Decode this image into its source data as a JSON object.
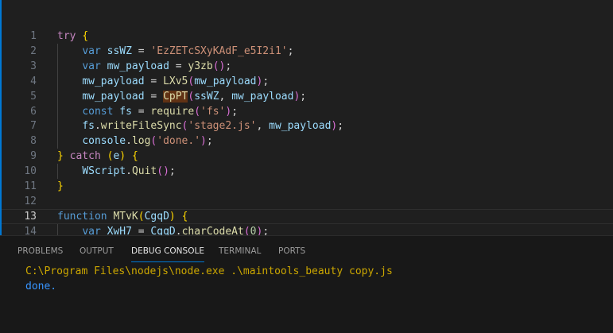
{
  "editor": {
    "active_line": 13,
    "highlight_token": "CpPT",
    "lines": [
      {
        "n": "1",
        "indent": 0,
        "t": [
          [
            "ctl",
            "try"
          ],
          [
            "",
            ""
          ],
          [
            "",
            " "
          ],
          [
            "b1",
            "{"
          ]
        ]
      },
      {
        "n": "2",
        "indent": 1,
        "t": [
          [
            "kw",
            "var"
          ],
          [
            "",
            " "
          ],
          [
            "id",
            "ssWZ"
          ],
          [
            "",
            " = "
          ],
          [
            "str",
            "'EzZETcSXyKAdF_e5I2i1'"
          ],
          [
            "",
            ";"
          ]
        ]
      },
      {
        "n": "3",
        "indent": 1,
        "t": [
          [
            "kw",
            "var"
          ],
          [
            "",
            " "
          ],
          [
            "id",
            "mw_payload"
          ],
          [
            "",
            " = "
          ],
          [
            "fn",
            "y3zb"
          ],
          [
            "b2",
            "()"
          ],
          [
            "",
            ";"
          ]
        ]
      },
      {
        "n": "4",
        "indent": 1,
        "t": [
          [
            "id",
            "mw_payload"
          ],
          [
            "",
            " = "
          ],
          [
            "fn",
            "LXv5"
          ],
          [
            "b2",
            "("
          ],
          [
            "id",
            "mw_payload"
          ],
          [
            "b2",
            ")"
          ],
          [
            "",
            ";"
          ]
        ]
      },
      {
        "n": "5",
        "indent": 1,
        "t": [
          [
            "id",
            "mw_payload"
          ],
          [
            "",
            " = "
          ],
          [
            "fn hl",
            "CpPT"
          ],
          [
            "b2",
            "("
          ],
          [
            "id",
            "ssWZ"
          ],
          [
            "",
            ", "
          ],
          [
            "id",
            "mw_payload"
          ],
          [
            "b2",
            ")"
          ],
          [
            "",
            ";"
          ]
        ]
      },
      {
        "n": "6",
        "indent": 1,
        "t": [
          [
            "kw",
            "const"
          ],
          [
            "",
            " "
          ],
          [
            "id",
            "fs"
          ],
          [
            "",
            " = "
          ],
          [
            "fn",
            "require"
          ],
          [
            "b2",
            "("
          ],
          [
            "str",
            "'fs'"
          ],
          [
            "b2",
            ")"
          ],
          [
            "",
            ";"
          ]
        ]
      },
      {
        "n": "7",
        "indent": 1,
        "t": [
          [
            "id",
            "fs"
          ],
          [
            "",
            "."
          ],
          [
            "fn",
            "writeFileSync"
          ],
          [
            "b2",
            "("
          ],
          [
            "str",
            "'stage2.js'"
          ],
          [
            "",
            ", "
          ],
          [
            "id",
            "mw_payload"
          ],
          [
            "b2",
            ")"
          ],
          [
            "",
            ";"
          ]
        ]
      },
      {
        "n": "8",
        "indent": 1,
        "t": [
          [
            "id",
            "console"
          ],
          [
            "",
            "."
          ],
          [
            "fn",
            "log"
          ],
          [
            "b2",
            "("
          ],
          [
            "str",
            "'done.'"
          ],
          [
            "b2",
            ")"
          ],
          [
            "",
            ";"
          ]
        ]
      },
      {
        "n": "9",
        "indent": 0,
        "t": [
          [
            "b1",
            "}"
          ],
          [
            "",
            " "
          ],
          [
            "ctl",
            "catch"
          ],
          [
            "",
            " "
          ],
          [
            "b1",
            "("
          ],
          [
            "id",
            "e"
          ],
          [
            "b1",
            ")"
          ],
          [
            "",
            " "
          ],
          [
            "b1",
            "{"
          ]
        ]
      },
      {
        "n": "10",
        "indent": 1,
        "t": [
          [
            "id",
            "WScript"
          ],
          [
            "",
            "."
          ],
          [
            "fn",
            "Quit"
          ],
          [
            "b2",
            "()"
          ],
          [
            "",
            ";"
          ]
        ]
      },
      {
        "n": "11",
        "indent": 0,
        "t": [
          [
            "b1",
            "}"
          ]
        ]
      },
      {
        "n": "12",
        "indent": 0,
        "t": []
      },
      {
        "n": "13",
        "indent": 0,
        "t": [
          [
            "kw",
            "function"
          ],
          [
            "",
            " "
          ],
          [
            "fn",
            "MTvK"
          ],
          [
            "b1",
            "("
          ],
          [
            "id",
            "CgqD"
          ],
          [
            "b1",
            ")"
          ],
          [
            "",
            " "
          ],
          [
            "b1",
            "{"
          ]
        ]
      },
      {
        "n": "14",
        "indent": 1,
        "t": [
          [
            "kw",
            "var"
          ],
          [
            "",
            " "
          ],
          [
            "id",
            "XwH7"
          ],
          [
            "",
            " = "
          ],
          [
            "id",
            "CgqD"
          ],
          [
            "",
            "."
          ],
          [
            "fn",
            "charCodeAt"
          ],
          [
            "b2",
            "("
          ],
          [
            "num",
            "0"
          ],
          [
            "b2",
            ")"
          ],
          [
            "",
            ";"
          ]
        ]
      }
    ]
  },
  "panel": {
    "tabs": [
      {
        "label": "PROBLEMS",
        "active": false
      },
      {
        "label": "OUTPUT",
        "active": false
      },
      {
        "label": "DEBUG CONSOLE",
        "active": true
      },
      {
        "label": "TERMINAL",
        "active": false
      },
      {
        "label": "PORTS",
        "active": false
      }
    ],
    "console": {
      "command": "C:\\Program Files\\nodejs\\node.exe .\\maintools_beauty copy.js",
      "output": "done."
    }
  },
  "colors": {
    "accent": "#0078d4",
    "command": "#cca700",
    "output": "#3794ff"
  }
}
